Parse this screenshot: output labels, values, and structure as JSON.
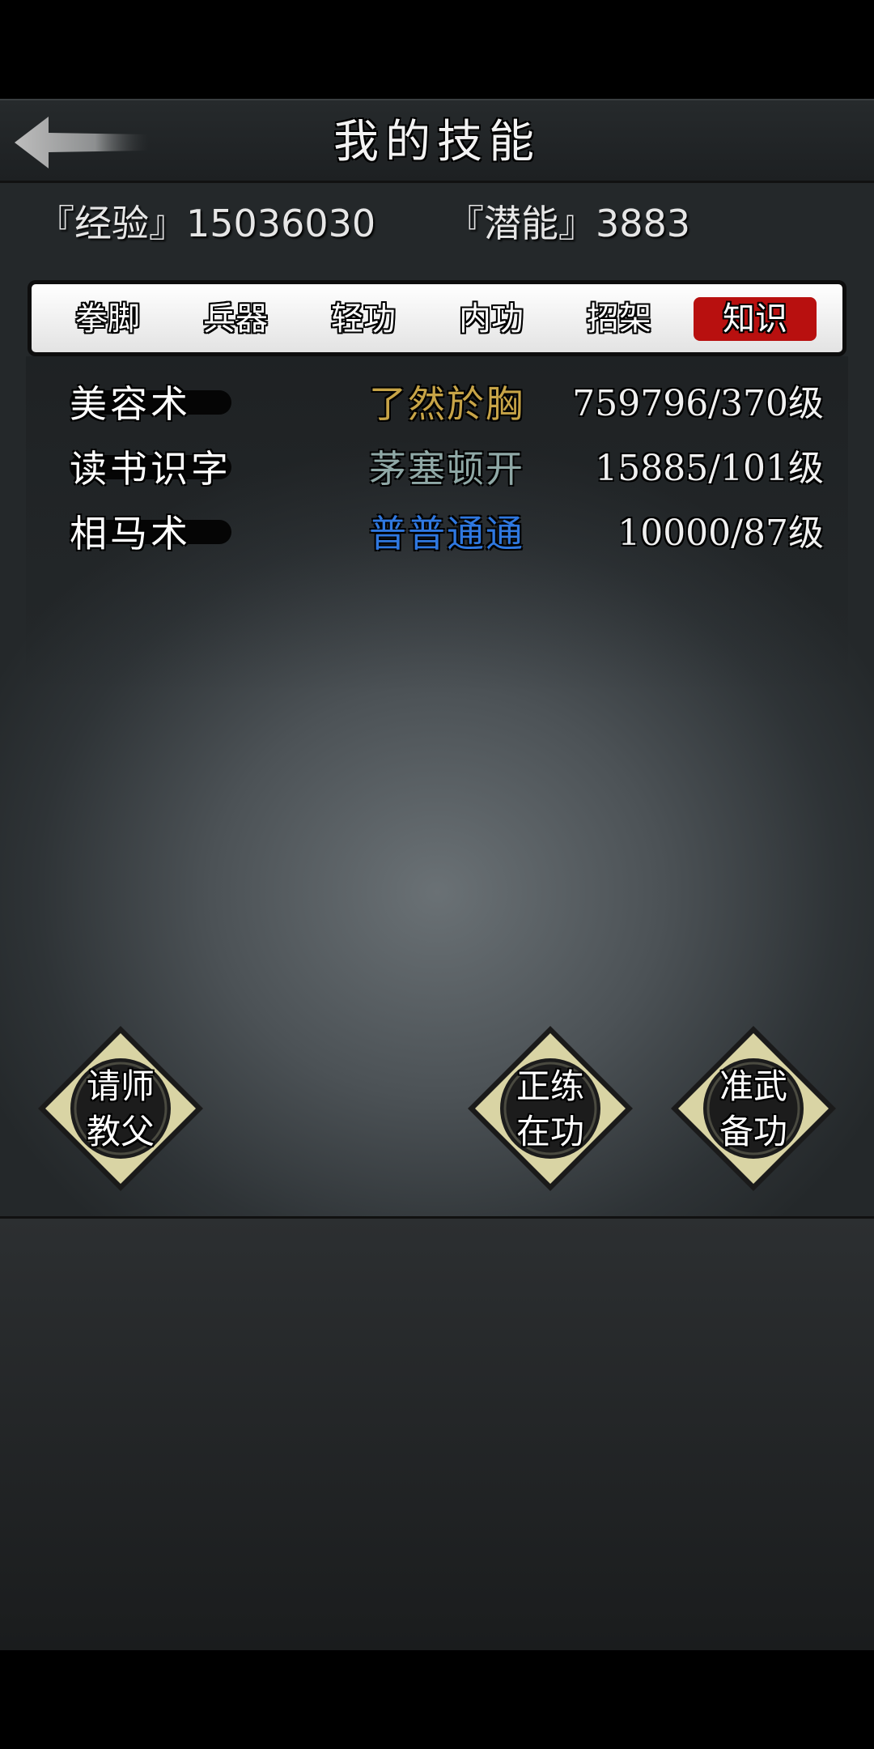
{
  "header": {
    "title": "我的技能"
  },
  "stats": {
    "exp_label": "『经验』",
    "exp_value": "15036030",
    "pot_label": "『潜能』",
    "pot_value": "3883"
  },
  "tabs": [
    {
      "label": "拳脚",
      "active": false
    },
    {
      "label": "兵器",
      "active": false
    },
    {
      "label": "轻功",
      "active": false
    },
    {
      "label": "内功",
      "active": false
    },
    {
      "label": "招架",
      "active": false
    },
    {
      "label": "知识",
      "active": true
    }
  ],
  "skills": [
    {
      "name": "美容术",
      "rank": "了然於胸",
      "rank_color": "#c7a447",
      "level": "759796/370级"
    },
    {
      "name": "读书识字",
      "rank": "茅塞顿开",
      "rank_color": "#8fa8a6",
      "level": "15885/101级"
    },
    {
      "name": "相马术",
      "rank": "普普通通",
      "rank_color": "#2f78e0",
      "level": "10000/87级"
    }
  ],
  "actions": {
    "ask_teacher": {
      "line1": "请师",
      "line2": "教父"
    },
    "practicing": {
      "line1": "正练",
      "line2": "在功"
    },
    "prepare": {
      "line1": "准武",
      "line2": "备功"
    }
  },
  "colors": {
    "active_tab": "#b8100f",
    "diamond_fill": "#d9d4a4"
  }
}
